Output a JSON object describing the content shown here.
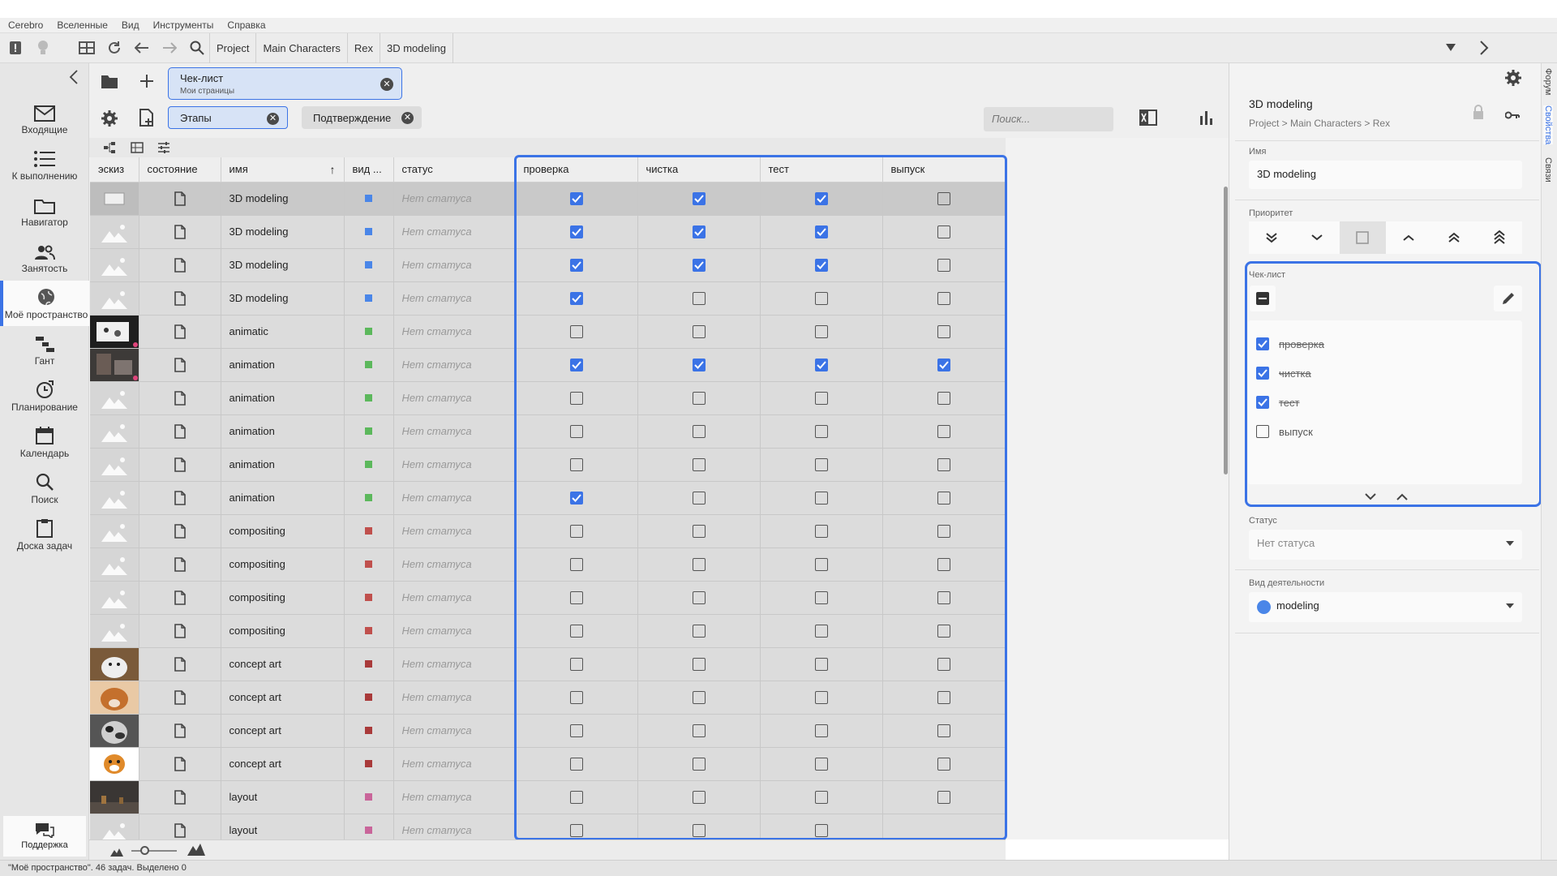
{
  "menubar": {
    "items": [
      "Cerebro",
      "Вселенные",
      "Вид",
      "Инструменты",
      "Справка"
    ]
  },
  "breadcrumbs": [
    "Project",
    "Main Characters",
    "Rex",
    "3D modeling"
  ],
  "nav": {
    "items": [
      {
        "label": "Входящие",
        "icon": "mail-icon"
      },
      {
        "label": "К выполнению",
        "icon": "list-icon"
      },
      {
        "label": "Навигатор",
        "icon": "folder-icon"
      },
      {
        "label": "Занятость",
        "icon": "people-icon"
      },
      {
        "label": "Моё пространство",
        "icon": "globe-icon",
        "active": true
      },
      {
        "label": "Гант",
        "icon": "gantt-icon"
      },
      {
        "label": "Планирование",
        "icon": "clock-icon"
      },
      {
        "label": "Календарь",
        "icon": "calendar-icon"
      },
      {
        "label": "Поиск",
        "icon": "search-icon"
      },
      {
        "label": "Доска задач",
        "icon": "clipboard-icon"
      }
    ],
    "support_label": "Поддержка"
  },
  "tabs": {
    "active_title": "Чек-лист",
    "active_subtitle": "Мои страницы"
  },
  "filters": {
    "stages_label": "Этапы",
    "confirm_label": "Подтверждение",
    "search_placeholder": "Поиск..."
  },
  "grid": {
    "columns": [
      "эскиз",
      "состояние",
      "имя",
      "вид ...",
      "статус",
      "проверка",
      "чистка",
      "тест",
      "выпуск"
    ],
    "sort_indicator": "↑",
    "rows": [
      {
        "name": "3D modeling",
        "color": "#4a86e8",
        "status": "Нет статуса",
        "checks": [
          true,
          true,
          true,
          false
        ],
        "thumb": "placeholder-sel",
        "selected": true
      },
      {
        "name": "3D modeling",
        "color": "#4a86e8",
        "status": "Нет статуса",
        "checks": [
          true,
          true,
          true,
          false
        ],
        "thumb": "placeholder"
      },
      {
        "name": "3D modeling",
        "color": "#4a86e8",
        "status": "Нет статуса",
        "checks": [
          true,
          true,
          true,
          false
        ],
        "thumb": "placeholder"
      },
      {
        "name": "3D modeling",
        "color": "#4a86e8",
        "status": "Нет статуса",
        "checks": [
          true,
          false,
          false,
          false
        ],
        "thumb": "placeholder"
      },
      {
        "name": "animatic",
        "color": "#5cb85c",
        "status": "Нет статуса",
        "checks": [
          false,
          false,
          false,
          false
        ],
        "thumb": "dark-sketch"
      },
      {
        "name": "animation",
        "color": "#5cb85c",
        "status": "Нет статуса",
        "checks": [
          true,
          true,
          true,
          true
        ],
        "thumb": "dark-scene"
      },
      {
        "name": "animation",
        "color": "#5cb85c",
        "status": "Нет статуса",
        "checks": [
          false,
          false,
          false,
          false
        ],
        "thumb": "placeholder"
      },
      {
        "name": "animation",
        "color": "#5cb85c",
        "status": "Нет статуса",
        "checks": [
          false,
          false,
          false,
          false
        ],
        "thumb": "placeholder"
      },
      {
        "name": "animation",
        "color": "#5cb85c",
        "status": "Нет статуса",
        "checks": [
          false,
          false,
          false,
          false
        ],
        "thumb": "placeholder"
      },
      {
        "name": "animation",
        "color": "#5cb85c",
        "status": "Нет статуса",
        "checks": [
          true,
          false,
          false,
          false
        ],
        "thumb": "placeholder"
      },
      {
        "name": "compositing",
        "color": "#c0504d",
        "status": "Нет статуса",
        "checks": [
          false,
          false,
          false,
          false
        ],
        "thumb": "placeholder"
      },
      {
        "name": "compositing",
        "color": "#c0504d",
        "status": "Нет статуса",
        "checks": [
          false,
          false,
          false,
          false
        ],
        "thumb": "placeholder"
      },
      {
        "name": "compositing",
        "color": "#c0504d",
        "status": "Нет статуса",
        "checks": [
          false,
          false,
          false,
          false
        ],
        "thumb": "placeholder"
      },
      {
        "name": "compositing",
        "color": "#c0504d",
        "status": "Нет статуса",
        "checks": [
          false,
          false,
          false,
          false
        ],
        "thumb": "placeholder"
      },
      {
        "name": "concept art",
        "color": "#a93a3a",
        "status": "Нет статуса",
        "checks": [
          false,
          false,
          false,
          false
        ],
        "thumb": "dog-white"
      },
      {
        "name": "concept art",
        "color": "#a93a3a",
        "status": "Нет статуса",
        "checks": [
          false,
          false,
          false,
          false
        ],
        "thumb": "dog-orange"
      },
      {
        "name": "concept art",
        "color": "#a93a3a",
        "status": "Нет статуса",
        "checks": [
          false,
          false,
          false,
          false
        ],
        "thumb": "dog-bw"
      },
      {
        "name": "concept art",
        "color": "#a93a3a",
        "status": "Нет статуса",
        "checks": [
          false,
          false,
          false,
          false
        ],
        "thumb": "dog-cartoon"
      },
      {
        "name": "layout",
        "color": "#c9659a",
        "status": "Нет статуса",
        "checks": [
          false,
          false,
          false,
          false
        ],
        "thumb": "dark-room"
      },
      {
        "name": "layout",
        "color": "#c9659a",
        "status": "Нет статуса",
        "checks": [
          false,
          false,
          false
        ],
        "thumb": "placeholder"
      }
    ]
  },
  "panel": {
    "title": "3D modeling",
    "path": "Project > Main Characters > Rex",
    "name_label": "Имя",
    "name_value": "3D modeling",
    "priority_label": "Приоритет",
    "checklist_label": "Чек-лист",
    "checklist": [
      {
        "label": "проверка",
        "done": true
      },
      {
        "label": "чистка",
        "done": true
      },
      {
        "label": "тест",
        "done": true
      },
      {
        "label": "выпуск",
        "done": false
      }
    ],
    "status_label": "Статус",
    "status_value": "Нет статуса",
    "activity_label": "Вид деятельности",
    "activity_value": "modeling",
    "activity_color": "#4a86e8"
  },
  "side_tabs": [
    "Форум",
    "Свойства",
    "Связи"
  ],
  "statusbar": {
    "text": "\"Моё пространство\". 46 задач. Выделено 0"
  },
  "colors": {
    "accent": "#3b73e6"
  }
}
